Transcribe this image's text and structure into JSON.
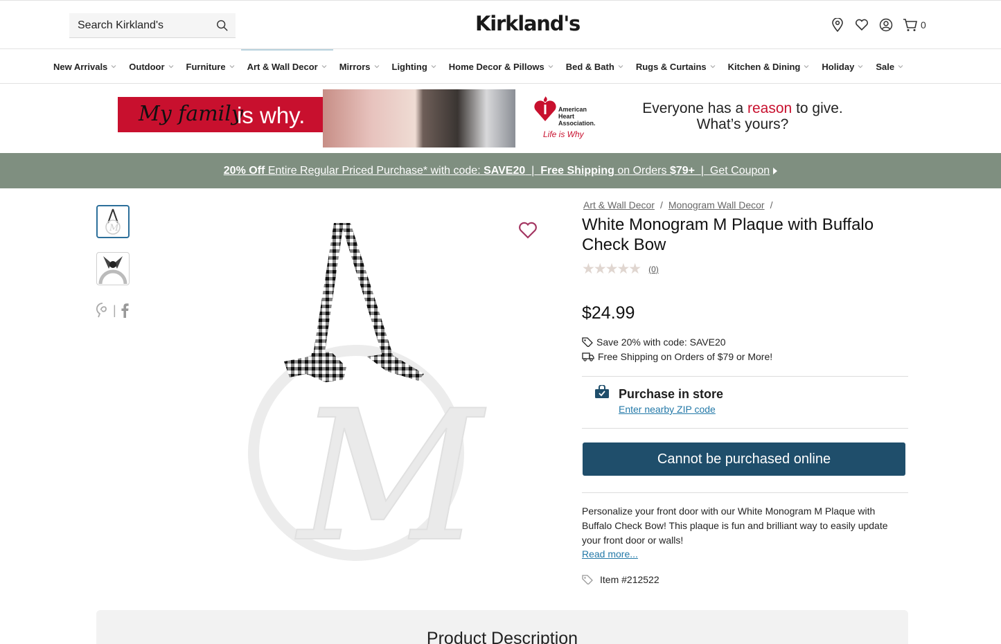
{
  "header": {
    "search_placeholder": "Search Kirkland's",
    "logo_text": "Kirkland's",
    "cart_count": "0",
    "icons": [
      "search-icon",
      "location-pin-icon",
      "heart-icon",
      "account-icon",
      "cart-icon"
    ]
  },
  "nav": {
    "items": [
      {
        "label": "New Arrivals"
      },
      {
        "label": "Outdoor"
      },
      {
        "label": "Furniture"
      },
      {
        "label": "Art & Wall Decor",
        "active": true
      },
      {
        "label": "Mirrors"
      },
      {
        "label": "Lighting"
      },
      {
        "label": "Home Decor & Pillows"
      },
      {
        "label": "Bed & Bath"
      },
      {
        "label": "Rugs & Curtains"
      },
      {
        "label": "Kitchen & Dining"
      },
      {
        "label": "Holiday"
      },
      {
        "label": "Sale"
      }
    ]
  },
  "banner": {
    "tag_1": "My family",
    "tag_2": "is why.",
    "org_name": "American Heart Association.",
    "org_tagline": "Life is Why",
    "message_1": "Everyone has a",
    "message_highlight": "reason",
    "message_2": "to give.",
    "message_3": "What’s yours?"
  },
  "promo": {
    "pct": "20% Off",
    "text_1": "Entire Regular Priced Purchase* with code:",
    "code": "SAVE20",
    "sep": "|",
    "ship": "Free Shipping",
    "ship_text": "on Orders",
    "ship_amount": "$79+",
    "coupon": "Get Coupon"
  },
  "product": {
    "breadcrumbs": [
      "Art & Wall Decor",
      "Monogram Wall Decor"
    ],
    "title": "White Monogram M Plaque with Buffalo Check Bow",
    "rating": 0,
    "review_count": "(0)",
    "price": "$24.99",
    "perk_save": "Save 20% with code: SAVE20",
    "perk_ship": "Free Shipping on Orders of $79 or More!",
    "store_title": "Purchase in store",
    "store_link": "Enter nearby ZIP code",
    "cta": "Cannot be purchased online",
    "description": "Personalize your front door with our White Monogram M Plaque with Buffalo Check Bow! This plaque is fun and brilliant way to easily update your front door or walls!",
    "read_more": "Read more...",
    "item_number": "Item #212522"
  },
  "colors": {
    "promo_bg": "#7f8f80",
    "cta_bg": "#1f4e6b",
    "link": "#2479a8",
    "brand_red": "#c8102e"
  },
  "section": {
    "product_description": "Product Description"
  }
}
